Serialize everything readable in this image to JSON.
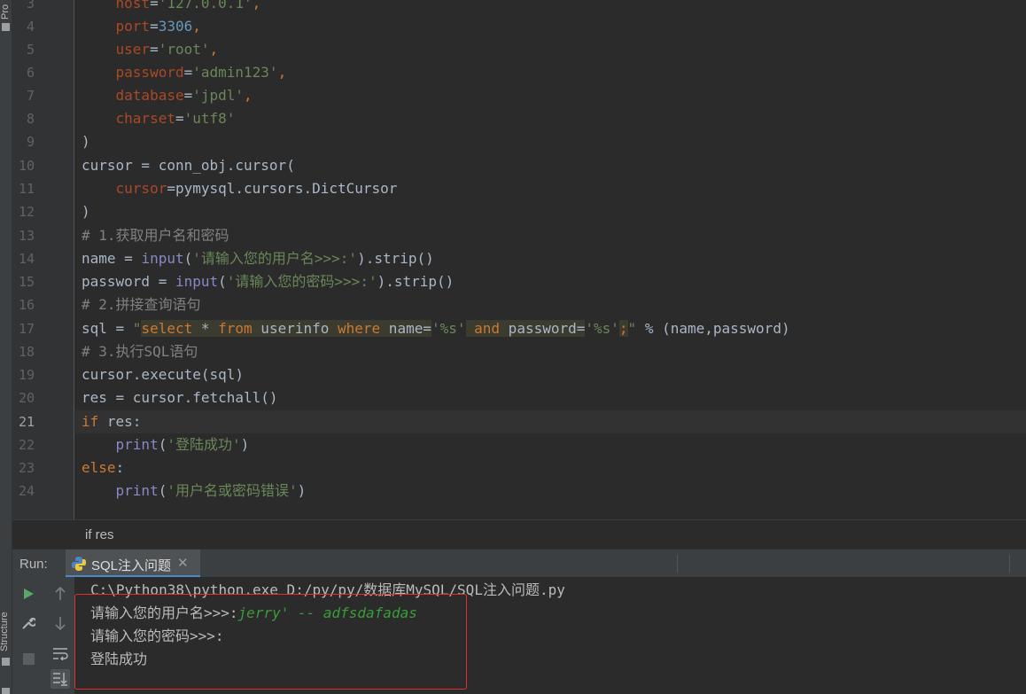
{
  "side_strip": {
    "top_label": "Pro",
    "bottom_label": "Structure"
  },
  "gutter": {
    "line_numbers": [
      "3",
      "4",
      "5",
      "6",
      "7",
      "8",
      "9",
      "10",
      "11",
      "12",
      "13",
      "14",
      "15",
      "16",
      "17",
      "18",
      "19",
      "20",
      "21",
      "22",
      "23",
      "24"
    ],
    "current_line": "21"
  },
  "code": {
    "l3": {
      "param": "host",
      "eq": "=",
      "str": "'127.0.0.1'",
      "comma": ","
    },
    "l4": {
      "param": "port",
      "eq": "=",
      "num": "3306",
      "comma": ","
    },
    "l5": {
      "param": "user",
      "eq": "=",
      "str": "'root'",
      "comma": ","
    },
    "l6": {
      "param": "password",
      "eq": "=",
      "str": "'admin123'",
      "comma": ","
    },
    "l7": {
      "param": "database",
      "eq": "=",
      "str": "'jpdl'",
      "comma": ","
    },
    "l8": {
      "param": "charset",
      "eq": "=",
      "str": "'utf8'"
    },
    "l9": {
      "text": ")"
    },
    "l10": {
      "text": "cursor = conn_obj.cursor("
    },
    "l11": {
      "param": "cursor",
      "text": "=pymysql.cursors.DictCursor"
    },
    "l12": {
      "text": ")"
    },
    "l13": {
      "comment": "# 1.获取用户名和密码"
    },
    "l14": {
      "pre": "name = ",
      "fn": "input",
      "open": "(",
      "str": "'请输入您的用户名>>>:'",
      "post": ").strip()"
    },
    "l15": {
      "pre": "password = ",
      "fn": "input",
      "open": "(",
      "str": "'请输入您的密码>>>:'",
      "post": ").strip()"
    },
    "l16": {
      "comment": "# 2.拼接查询语句"
    },
    "l17": {
      "pre": "sql = ",
      "q1": "\"",
      "k_select": "select",
      "star": " * ",
      "k_from": "from",
      "tbl": " userinfo ",
      "k_where": "where",
      "col1": " name=",
      "s1": "'%s'",
      "sp": " ",
      "k_and": "and",
      "col2": " password=",
      "s2": "'%s'",
      "semi": ";",
      "q2": "\"",
      "post": " % (name,password)"
    },
    "l18": {
      "comment": "# 3.执行SQL语句"
    },
    "l19": {
      "text": "cursor.execute(sql)"
    },
    "l20": {
      "text": "res = cursor.fetchall()"
    },
    "l21": {
      "kw": "if",
      "text": " res:"
    },
    "l22": {
      "indent": "    ",
      "fn": "print",
      "open": "(",
      "str": "'登陆成功'",
      "close": ")"
    },
    "l23": {
      "kw": "else",
      "text": ":"
    },
    "l24": {
      "indent": "    ",
      "fn": "print",
      "open": "(",
      "str": "'用户名或密码错误'",
      "close": ")"
    }
  },
  "breadcrumb": "if res",
  "run": {
    "label": "Run:",
    "tab_title": "SQL注入问题",
    "close": "✕"
  },
  "console": {
    "command": "C:\\Python38\\python.exe D:/py/py/数据库MySQL/SQL注入问题.py",
    "prompt_user": "请输入您的用户名>>>:",
    "user_input": "jerry' -- adfsdafadas",
    "prompt_password": "请输入您的密码>>>:",
    "result": "登陆成功"
  },
  "colors": {
    "background": "#2b2b2b",
    "keyword": "#cc7832",
    "string": "#6a8759",
    "number": "#6897bb",
    "param": "#aa4926",
    "highlight_box": "#e0302f"
  }
}
